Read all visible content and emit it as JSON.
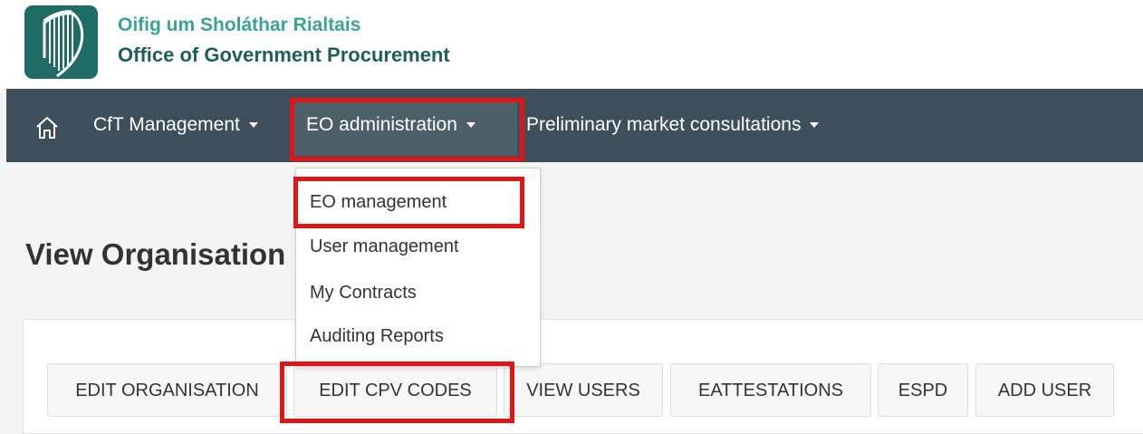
{
  "brand": {
    "name_irish": "Oifig um Sholáthar Rialtais",
    "name_english": "Office of Government Procurement",
    "logo_icon": "harp-icon",
    "colors": {
      "logo_bg": "#1f6b66",
      "irish_text": "#3aa399",
      "english_text": "#1f5f5a"
    }
  },
  "navbar": {
    "home_icon": "home-icon",
    "background": "#3c4f5b",
    "items": [
      {
        "label": "CfT Management"
      },
      {
        "label": "EO administration"
      },
      {
        "label": "Preliminary market consultations"
      }
    ]
  },
  "dropdown": {
    "items": [
      {
        "label": "EO management"
      },
      {
        "label": "User management"
      },
      {
        "label": "My Contracts"
      },
      {
        "label": "Auditing Reports"
      }
    ]
  },
  "page": {
    "title": "View Organisation"
  },
  "actions": [
    {
      "label": "EDIT ORGANISATION"
    },
    {
      "label": "EDIT CPV CODES"
    },
    {
      "label": "VIEW USERS"
    },
    {
      "label": "EATTESTATIONS"
    },
    {
      "label": "ESPD"
    },
    {
      "label": "ADD USER"
    }
  ],
  "highlight_color": "#e01515"
}
